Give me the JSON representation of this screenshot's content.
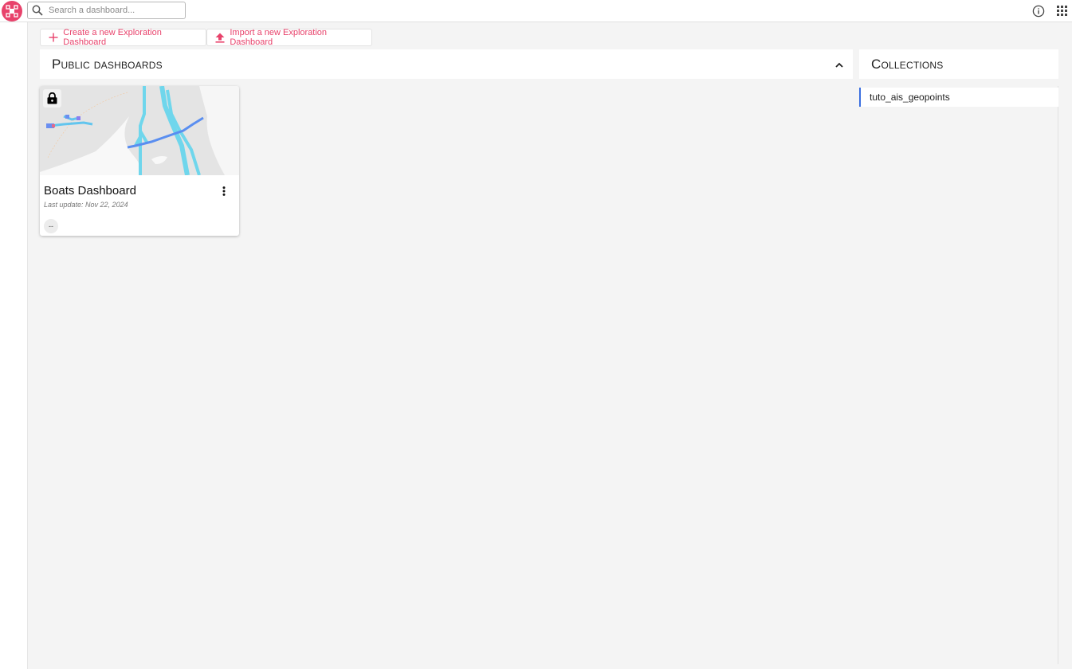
{
  "topbar": {
    "logo_icon": "arlas-logo-icon",
    "search": {
      "placeholder": "Search a dashboard...",
      "value": ""
    },
    "info_icon": "info-icon",
    "apps_icon": "apps-grid-icon"
  },
  "actions": {
    "create_label": "Create a new Exploration Dashboard",
    "import_label": "Import a new Exploration Dashboard"
  },
  "public_dashboards": {
    "title": "Public dashboards",
    "collapse_icon": "chevron-up-icon",
    "cards": [
      {
        "title": "Boats Dashboard",
        "last_update": "Last update: Nov 22, 2024",
        "locked": true,
        "tag": "--",
        "thumbnail": "map-preview"
      }
    ]
  },
  "collections": {
    "title": "Collections",
    "items": [
      {
        "label": "tuto_ais_geopoints"
      }
    ]
  },
  "colors": {
    "accent": "#e8426b",
    "collection_marker": "#3b6fe0",
    "background": "#f4f4f4"
  }
}
